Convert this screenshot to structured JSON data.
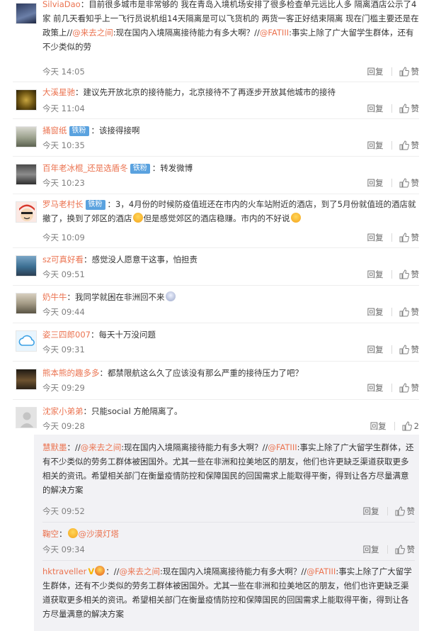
{
  "labels": {
    "reply": "回复",
    "like": "赞"
  },
  "comments": [
    {
      "user": "SilviaDao",
      "sep": "：",
      "text": "目前很多城市是非常够的 我在青岛入境机场安排了很多检查单元远比人多 隔离酒店公示了4家 前几天看知乎上一飞行员说机组14天隔离是可以飞货机的 两货一客正好结束隔离 现在门槛主要还是在政策上//",
      "m1": "@来去之间",
      "t2": ":现在国内入境隔离接待能力有多大啊？//",
      "m2": "@FATIII",
      "t3": ":事实上除了广大留学生群体，还有不少类似的劳",
      "time": "今天 14:05",
      "likes": ""
    },
    {
      "user": "大溪星驰",
      "sep": "：",
      "text": "建议先开放北京的接待能力，北京接待不了再逐步开放其他城市的接待",
      "time": "今天 11:04",
      "likes": ""
    },
    {
      "user": "捅窗纸",
      "badge": "铁粉",
      "sep": "：",
      "text": "该接得接啊",
      "time": "今天 10:35",
      "likes": ""
    },
    {
      "user": "百年老冰棍_还是选盾冬",
      "badge": "铁粉",
      "sep": "：",
      "text": "转发微博",
      "time": "今天 10:23",
      "likes": ""
    },
    {
      "user": "罗马老村长",
      "badge": "铁粉",
      "sep": "：",
      "text": "3，4月份的时候防疫值班还在市内的火车站附近的酒店，到了5月份就值班的酒店就撤了，换到了郊区的酒店",
      "t2": "但是感觉郊区的酒店稳赚。市内的不好说",
      "time": "今天 10:09",
      "likes": ""
    },
    {
      "user": "sz可真好看",
      "sep": "：",
      "text": "感觉没人愿意干这事，怕担责",
      "time": "今天 09:51",
      "likes": ""
    },
    {
      "user": "奶牛牛",
      "sep": "：",
      "text": "我同学就困在非洲回不来",
      "time": "今天 09:44",
      "likes": ""
    },
    {
      "user": "姿三四郎007",
      "sep": "：",
      "text": "每天十万没问题",
      "time": "今天 09:31",
      "likes": ""
    },
    {
      "user": "熊本熊的趣多多",
      "sep": "：",
      "text": "都禁限航这么久了应该没有那么严重的接待压力了吧？",
      "time": "今天 09:29",
      "likes": ""
    },
    {
      "user": "沈家小弟弟",
      "sep": "：",
      "text": "只能social 方舱隔离了。",
      "time": "今天 09:28",
      "likes": "2"
    }
  ],
  "children": [
    {
      "user": "慧默墨",
      "sep": "：//",
      "m1": "@来去之间",
      "t1": ":现在国内入境隔离接待能力有多大啊？//",
      "m2": "@FATIII",
      "t2": ":事实上除了广大留学生群体，还有不少类似的劳务工群体被困国外。尤其一些在非洲和拉美地区的朋友，他们也许更缺乏渠道获取更多相关的资讯。希望相关部门在衡量疫情防控和保障国民的回国需求上能取得平衡，得到让各方尽量满意的解决方案",
      "time": "今天 09:52",
      "likes": ""
    },
    {
      "user": "鞠空",
      "sep": "：",
      "m1": "@沙漠灯塔",
      "time": "今天 09:34",
      "likes": ""
    },
    {
      "user": "hktraveller",
      "sep": "：//",
      "m1": "@来去之间",
      "t1": ":现在国内入境隔离接待能力有多大啊？//",
      "m2": "@FATIII",
      "t2": ":事实上除了广大留学生群体，还有不少类似的劳务工群体被困国外。尤其一些在非洲和拉美地区的朋友，他们也许更缺乏渠道获取更多相关的资讯。希望相关部门在衡量疫情防控和保障国民的回国需求上能取得平衡，得到让各方尽量满意的解决方案"
    }
  ],
  "colors": {
    "link": "#eb7350",
    "badge": "#5aa2df",
    "time": "#808080",
    "child_bg": "#f2f2f5"
  },
  "icons": {
    "like": "thumb-up-icon"
  }
}
